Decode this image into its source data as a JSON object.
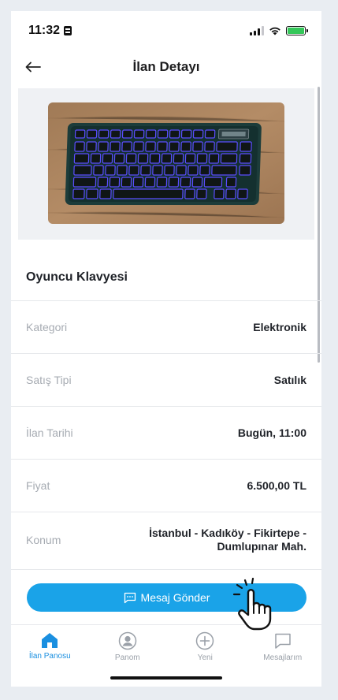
{
  "status_bar": {
    "time": "11:32"
  },
  "header": {
    "title": "İlan Detayı"
  },
  "listing": {
    "title": "Oyuncu Klavyesi",
    "details": [
      {
        "label": "Kategori",
        "value": "Elektronik"
      },
      {
        "label": "Satış Tipi",
        "value": "Satılık"
      },
      {
        "label": "İlan Tarihi",
        "value": "Bugün, 11:00"
      },
      {
        "label": "Fiyat",
        "value": "6.500,00 TL"
      },
      {
        "label": "Konum",
        "value_line1": "İstanbul - Kadıköy - Fikirtepe -",
        "value_line2": "Dumlupınar Mah."
      }
    ]
  },
  "message_button": {
    "label": "Mesaj Gönder"
  },
  "tabs": [
    {
      "label": "İlan Panosu",
      "icon": "home-icon",
      "active": true
    },
    {
      "label": "Panom",
      "icon": "user-icon",
      "active": false
    },
    {
      "label": "Yeni",
      "icon": "plus-circle-icon",
      "active": false
    },
    {
      "label": "Mesajlarım",
      "icon": "chat-icon",
      "active": false
    }
  ],
  "colors": {
    "accent": "#1aa3e8",
    "tab_active": "#1a8fe0",
    "label_gray": "#a6abb2"
  }
}
